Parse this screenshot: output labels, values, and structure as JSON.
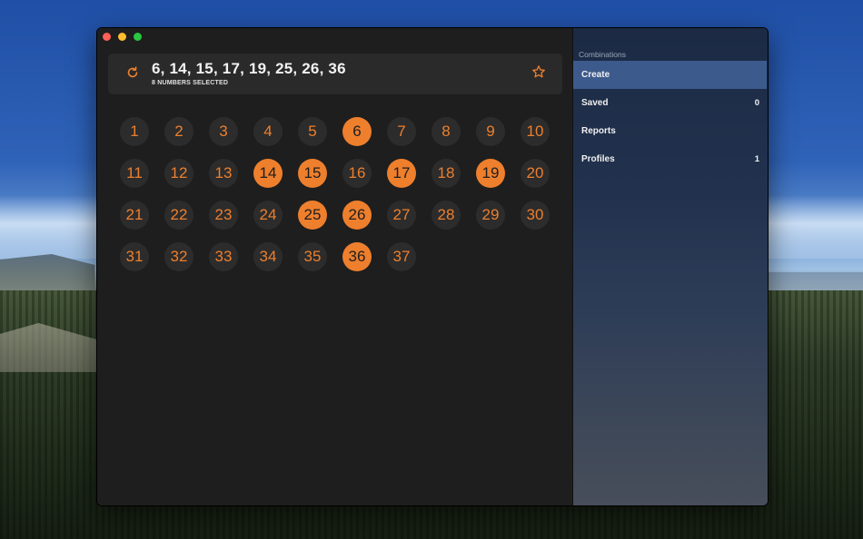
{
  "selection": {
    "numbers_text": "6, 14, 15, 17, 19, 25, 26, 36",
    "count_text": "8 NUMBERS SELECTED"
  },
  "numbers": [
    1,
    2,
    3,
    4,
    5,
    6,
    7,
    8,
    9,
    10,
    11,
    12,
    13,
    14,
    15,
    16,
    17,
    18,
    19,
    20,
    21,
    22,
    23,
    24,
    25,
    26,
    27,
    28,
    29,
    30,
    31,
    32,
    33,
    34,
    35,
    36,
    37
  ],
  "selected": [
    6,
    14,
    15,
    17,
    19,
    25,
    26,
    36
  ],
  "sidebar": {
    "section": "Combinations",
    "items": [
      {
        "label": "Create",
        "badge": "",
        "active": true
      },
      {
        "label": "Saved",
        "badge": "0",
        "active": false
      },
      {
        "label": "Reports",
        "badge": "",
        "active": false
      },
      {
        "label": "Profiles",
        "badge": "1",
        "active": false
      }
    ]
  },
  "colors": {
    "accent": "#ee7f2d",
    "ball_bg": "#2c2c2c",
    "sidebar_active": "#3d5a8c"
  },
  "icons": {
    "reset": "refresh-icon",
    "favorite": "star-icon"
  }
}
